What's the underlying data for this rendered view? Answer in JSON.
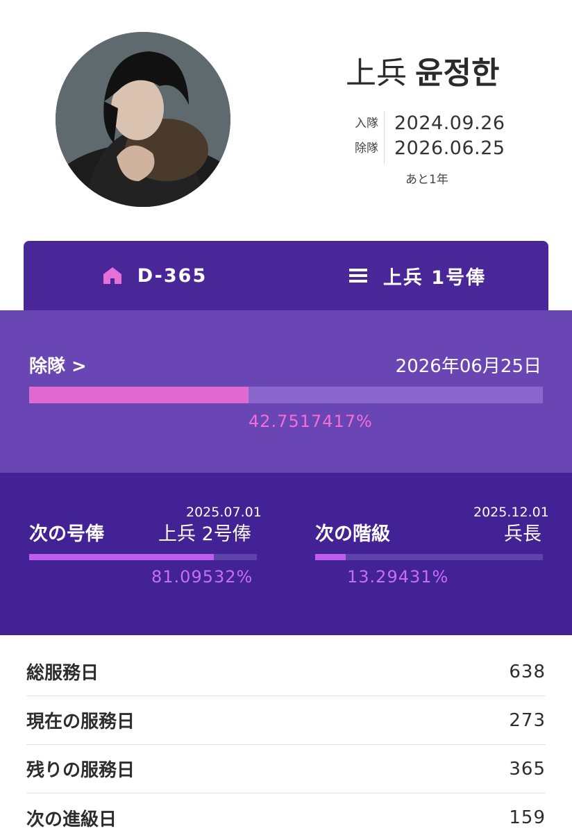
{
  "profile": {
    "rank": "上兵",
    "name": "윤정한",
    "enlist_label": "入隊",
    "enlist_date": "2024.09.26",
    "discharge_label": "除隊",
    "discharge_date": "2026.06.25",
    "remaining_text": "あと1年"
  },
  "tabs": [
    {
      "label": "D-365",
      "icon": "home-icon"
    },
    {
      "label": "上兵 1号俸",
      "icon": "menu-icon"
    }
  ],
  "discharge": {
    "label": "除隊 >",
    "date": "2026年06月25日",
    "percent_text": "42.7517417%",
    "progress": 0.427517417
  },
  "next_pay": {
    "title": "次の号俸",
    "date": "2025.07.01",
    "target": "上兵 2号俸",
    "percent_text": "81.09532%",
    "progress": 0.8109532
  },
  "next_rank": {
    "title": "次の階級",
    "date": "2025.12.01",
    "target": "兵長",
    "percent_text": "13.29431%",
    "progress": 0.1329431
  },
  "stats": [
    {
      "label": "総服務日",
      "value": "638"
    },
    {
      "label": "現在の服務日",
      "value": "273"
    },
    {
      "label": "残りの服務日",
      "value": "365"
    },
    {
      "label": "次の進級日",
      "value": "159"
    }
  ],
  "colors": {
    "tab_bar": "#4a2799",
    "discharge_bg": "#6a45b4",
    "next_bg": "#422294",
    "discharge_fill": "#e06ad2",
    "next_fill": "#c15cf2"
  }
}
